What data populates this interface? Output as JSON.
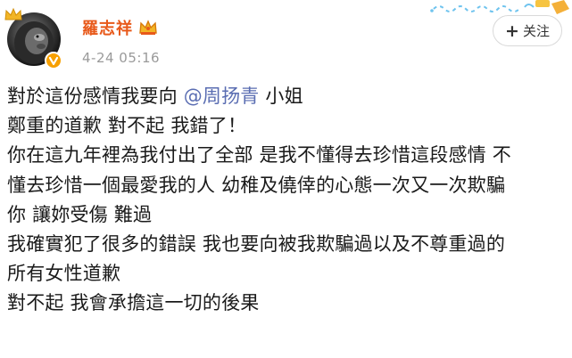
{
  "header": {
    "username": "羅志祥",
    "timestamp": "4-24 05:16",
    "follow_label": "关注",
    "follow_plus": "+",
    "colors": {
      "username": "#e8591a",
      "mention": "#5a6db2",
      "verified": "#f7a000"
    }
  },
  "post": {
    "line1_a": "對於這份感情我要向 ",
    "mention": "@周扬青",
    "line1_b": " 小姐",
    "lines": [
      "鄭重的道歉 對不起 我錯了！",
      "你在這九年裡為我付出了全部 是我不懂得去珍惜這段感情 不",
      "懂去珍惜一個最愛我的人 幼稚及僥倖的心態一次又一次欺騙",
      "你 讓妳受傷 難過",
      "我確實犯了很多的錯誤 我也要向被我欺騙過以及不尊重過的",
      "所有女性道歉",
      "對不起   我會承擔這一切的後果"
    ]
  },
  "icons": {
    "avatar": "lion-avatar",
    "crown": "crown-icon",
    "verified": "verified-badge-icon",
    "decoration": "water-wave-decoration"
  }
}
